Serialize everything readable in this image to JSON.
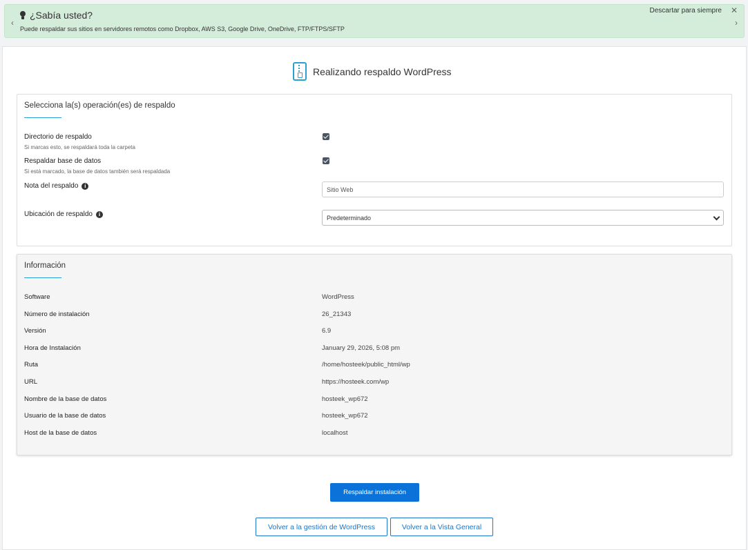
{
  "tip": {
    "title": "¿Sabía usted?",
    "text": "Puede respaldar sus sitios en servidores remotos como Dropbox, AWS S3, Google Drive, OneDrive, FTP/FTPS/SFTP",
    "dismiss_label": "Descartar para siempre",
    "prev_icon": "‹",
    "next_icon": "›",
    "close_icon": "✕"
  },
  "page": {
    "title": "Realizando respaldo WordPress",
    "icon": "zip-file-icon"
  },
  "operations": {
    "heading": "Selecciona la(s) operación(es) de respaldo",
    "backup_dir": {
      "label": "Directorio de respaldo",
      "sub": "Si marcas esto, se respaldará toda la carpeta",
      "checked": true
    },
    "backup_db": {
      "label": "Respaldar base de datos",
      "sub": "Si está marcado, la base de datos también será respaldada",
      "checked": true
    },
    "note": {
      "label": "Nota del respaldo",
      "value": "Sitio Web"
    },
    "location": {
      "label": "Ubicación de respaldo",
      "selected": "Predeterminado"
    },
    "info_icon": "i"
  },
  "info": {
    "heading": "Información",
    "rows": [
      {
        "key": "Software",
        "value": "WordPress"
      },
      {
        "key": "Número de instalación",
        "value": "26_21343"
      },
      {
        "key": "Versión",
        "value": "6.9"
      },
      {
        "key": "Hora de Instalación",
        "value": "January 29, 2026, 5:08 pm"
      },
      {
        "key": "Ruta",
        "value": "/home/hosteek/public_html/wp"
      },
      {
        "key": "URL",
        "value": "https://hosteek.com/wp"
      },
      {
        "key": "Nombre de la base de datos",
        "value": "hosteek_wp672"
      },
      {
        "key": "Usuario de la base de datos",
        "value": "hosteek_wp672"
      },
      {
        "key": "Host de la base de datos",
        "value": "localhost"
      }
    ]
  },
  "actions": {
    "backup": "Respaldar instalación",
    "back_wp": "Volver a la gestión de WordPress",
    "back_overview": "Volver a la Vista General"
  },
  "colors": {
    "accent": "#0a72d9",
    "tip_bg": "#d4edda"
  }
}
